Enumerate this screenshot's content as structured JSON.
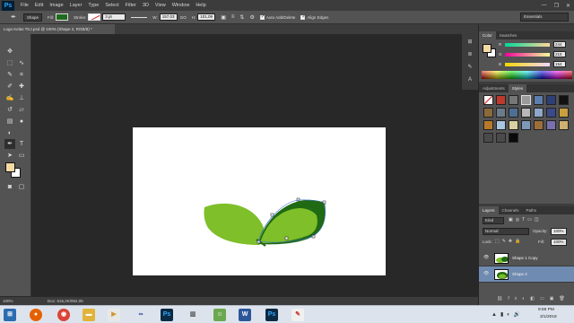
{
  "app": {
    "logo": "Ps",
    "menu": [
      "File",
      "Edit",
      "Image",
      "Layer",
      "Type",
      "Select",
      "Filter",
      "3D",
      "View",
      "Window",
      "Help"
    ],
    "window_controls": [
      "—",
      "❐",
      "✕"
    ]
  },
  "options": {
    "tool_mode": "Shape",
    "fill_label": "Fill:",
    "stroke_label": "Stroke:",
    "stroke_width": "3 pt",
    "w_label": "W:",
    "w_value": "157,03",
    "link_label": "GO",
    "h_label": "H:",
    "h_value": "101,09",
    "auto_add_delete": "Auto Add/Delete",
    "align_edges": "Align Edges",
    "workspace": "Essentials",
    "colors": {
      "fill": "#1e6b1e",
      "stroke": "#ffffff"
    }
  },
  "document": {
    "tab_title": "Logo Kelas TKJ.psd @ 100% (Shape 2, RGB/8) *",
    "zoom": "100%",
    "doc_size": "Doc: 615,2K/952,0K",
    "shapes": {
      "leaf_light": "#7ebf2a",
      "leaf_dark": "#1f6a12"
    }
  },
  "toolbox": {
    "tools": [
      "move-icon",
      "marquee-icon",
      "lasso-icon",
      "quick-select-icon",
      "crop-icon",
      "eyedropper-icon",
      "healing-icon",
      "brush-icon",
      "clone-stamp-icon",
      "history-brush-icon",
      "eraser-icon",
      "gradient-icon",
      "blur-icon",
      "dodge-icon",
      "pen-icon",
      "type-icon",
      "path-select-icon",
      "shape-icon",
      "hand-icon",
      "zoom-icon"
    ],
    "foreground_color": "#f3d9a4",
    "background_color": "#ffffff"
  },
  "color_panel": {
    "tabs": [
      "Color",
      "Swatches"
    ],
    "r_label": "R",
    "r_value": "244",
    "g_label": "G",
    "g_value": "215",
    "b_label": "B",
    "b_value": "154"
  },
  "styles_panel": {
    "tabs": [
      "Adjustments",
      "Styles"
    ]
  },
  "layers_panel": {
    "tabs": [
      "Layers",
      "Channels",
      "Paths"
    ],
    "filter_kind": "Kind",
    "blend_mode": "Normal",
    "opacity_label": "Opacity:",
    "opacity_value": "100%",
    "lock_label": "Lock:",
    "fill_label": "Fill:",
    "fill_value": "100%",
    "layers": [
      {
        "name": "Shape 1 Copy",
        "selected": false
      },
      {
        "name": "Shape 2",
        "selected": true
      }
    ]
  },
  "taskbar": {
    "time": "9:59 PM",
    "date": "3/1/2018"
  }
}
